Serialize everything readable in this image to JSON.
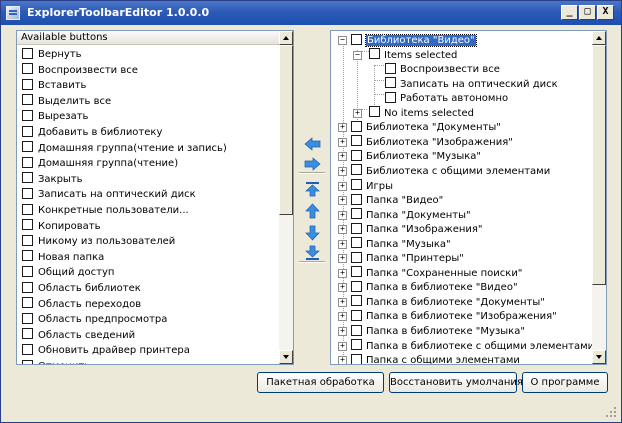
{
  "window": {
    "title": "ExplorerToolbarEditor 1.0.0.0"
  },
  "caption_buttons": {
    "minimize": "_",
    "maximize": "□",
    "close": "X"
  },
  "available": {
    "header": "Available buttons",
    "items": [
      "Вернуть",
      "Воспроизвести все",
      "Вставить",
      "Выделить все",
      "Вырезать",
      "Добавить в библиотеку",
      "Домашняя группа(чтение и запись)",
      "Домашняя группа(чтение)",
      "Закрыть",
      "Записать на оптический диск",
      "Конкретные пользователи...",
      "Копировать",
      "Никому из пользователей",
      "Новая папка",
      "Общий доступ",
      "Область библиотек",
      "Область переходов",
      "Область предпросмотра",
      "Область сведений",
      "Обновить драйвер принтера",
      "Отменить"
    ]
  },
  "tree": {
    "nodes": [
      {
        "label": "Библиотека \"Видео\"",
        "level": 0,
        "expander": "−",
        "selected": true
      },
      {
        "label": "Items selected",
        "level": 1,
        "expander": "−"
      },
      {
        "label": "Воспроизвести все",
        "level": 2,
        "expander": ""
      },
      {
        "label": "Записать на оптический диск",
        "level": 2,
        "expander": ""
      },
      {
        "label": "Работать автономно",
        "level": 2,
        "expander": ""
      },
      {
        "label": "No items selected",
        "level": 1,
        "expander": "+"
      },
      {
        "label": "Библиотека \"Документы\"",
        "level": 0,
        "expander": "+"
      },
      {
        "label": "Библиотека \"Изображения\"",
        "level": 0,
        "expander": "+"
      },
      {
        "label": "Библиотека \"Музыка\"",
        "level": 0,
        "expander": "+"
      },
      {
        "label": "Библиотека с общими элементами",
        "level": 0,
        "expander": "+"
      },
      {
        "label": "Игры",
        "level": 0,
        "expander": "+"
      },
      {
        "label": "Папка \"Видео\"",
        "level": 0,
        "expander": "+"
      },
      {
        "label": "Папка \"Документы\"",
        "level": 0,
        "expander": "+"
      },
      {
        "label": "Папка \"Изображения\"",
        "level": 0,
        "expander": "+"
      },
      {
        "label": "Папка \"Музыка\"",
        "level": 0,
        "expander": "+"
      },
      {
        "label": "Папка \"Принтеры\"",
        "level": 0,
        "expander": "+"
      },
      {
        "label": "Папка \"Сохраненные поиски\"",
        "level": 0,
        "expander": "+"
      },
      {
        "label": "Папка в библиотеке \"Видео\"",
        "level": 0,
        "expander": "+"
      },
      {
        "label": "Папка в библиотеке \"Документы\"",
        "level": 0,
        "expander": "+"
      },
      {
        "label": "Папка в библиотеке \"Изображения\"",
        "level": 0,
        "expander": "+"
      },
      {
        "label": "Папка в библиотеке \"Музыка\"",
        "level": 0,
        "expander": "+"
      },
      {
        "label": "Папка в библиотеке с общими элементами",
        "level": 0,
        "expander": "+"
      },
      {
        "label": "Папка с общими элементами",
        "level": 0,
        "expander": "+"
      }
    ]
  },
  "middle_buttons": [
    {
      "name": "move-left-icon",
      "dir": "left"
    },
    {
      "name": "move-right-icon",
      "dir": "right"
    },
    {
      "name": "move-top-icon",
      "dir": "top"
    },
    {
      "name": "move-up-icon",
      "dir": "up"
    },
    {
      "name": "move-down-icon",
      "dir": "down"
    },
    {
      "name": "move-bottom-icon",
      "dir": "bottom"
    }
  ],
  "buttons": {
    "batch": "Пакетная обработка",
    "restore": "Восстановить умолчания",
    "about": "О программе"
  },
  "colors": {
    "title_bar": "#2c5bb7",
    "selection": "#316ac5",
    "arrow": "#3b8de0"
  }
}
